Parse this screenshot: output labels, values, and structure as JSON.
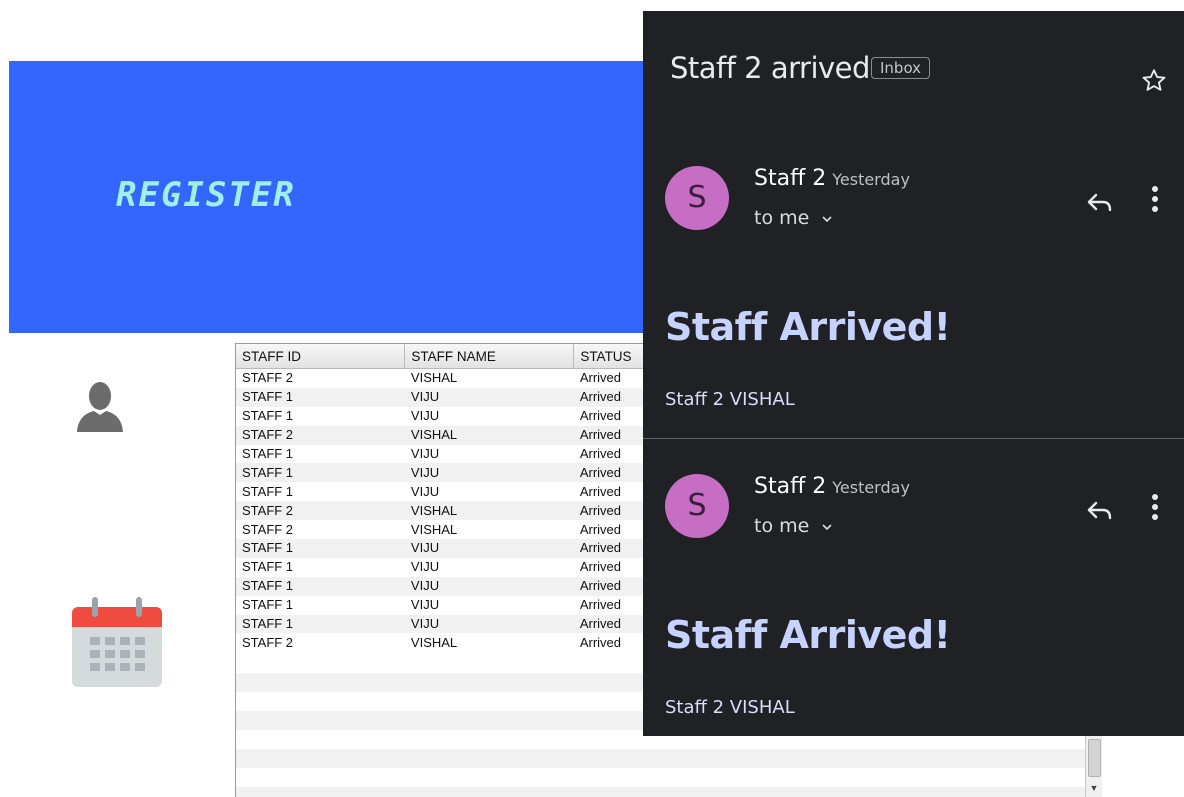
{
  "register": {
    "title": "REGISTER",
    "icons": [
      "user-icon",
      "calendar-icon"
    ],
    "colors": {
      "banner": "#3366ff",
      "title": "#9ff0e8"
    }
  },
  "table": {
    "columns": [
      "STAFF ID",
      "STAFF NAME",
      "STATUS"
    ],
    "rows": [
      [
        "STAFF 2",
        "VISHAL",
        "Arrived"
      ],
      [
        "STAFF 1",
        "VIJU",
        "Arrived"
      ],
      [
        "STAFF 1",
        "VIJU",
        "Arrived"
      ],
      [
        "STAFF 2",
        "VISHAL",
        "Arrived"
      ],
      [
        "STAFF 1",
        "VIJU",
        "Arrived"
      ],
      [
        "STAFF 1",
        "VIJU",
        "Arrived"
      ],
      [
        "STAFF 1",
        "VIJU",
        "Arrived"
      ],
      [
        "STAFF 2",
        "VISHAL",
        "Arrived"
      ],
      [
        "STAFF 2",
        "VISHAL",
        "Arrived"
      ],
      [
        "STAFF 1",
        "VIJU",
        "Arrived"
      ],
      [
        "STAFF 1",
        "VIJU",
        "Arrived"
      ],
      [
        "STAFF 1",
        "VIJU",
        "Arrived"
      ],
      [
        "STAFF 1",
        "VIJU",
        "Arrived"
      ],
      [
        "STAFF 1",
        "VIJU",
        "Arrived"
      ],
      [
        "STAFF 2",
        "VISHAL",
        "Arrived"
      ]
    ]
  },
  "email": {
    "subject": "Staff 2 arrived",
    "label": "Inbox",
    "colors": {
      "background": "#202124",
      "avatar": "#c56ec4",
      "headline": "#c6d2ff"
    },
    "messages": [
      {
        "avatar_letter": "S",
        "sender": "Staff 2",
        "time": "Yesterday",
        "recipient": "to me",
        "headline": "Staff Arrived!",
        "body": "Staff 2 VISHAL"
      },
      {
        "avatar_letter": "S",
        "sender": "Staff 2",
        "time": "Yesterday",
        "recipient": "to me",
        "headline": "Staff Arrived!",
        "body": "Staff 2 VISHAL"
      }
    ]
  }
}
